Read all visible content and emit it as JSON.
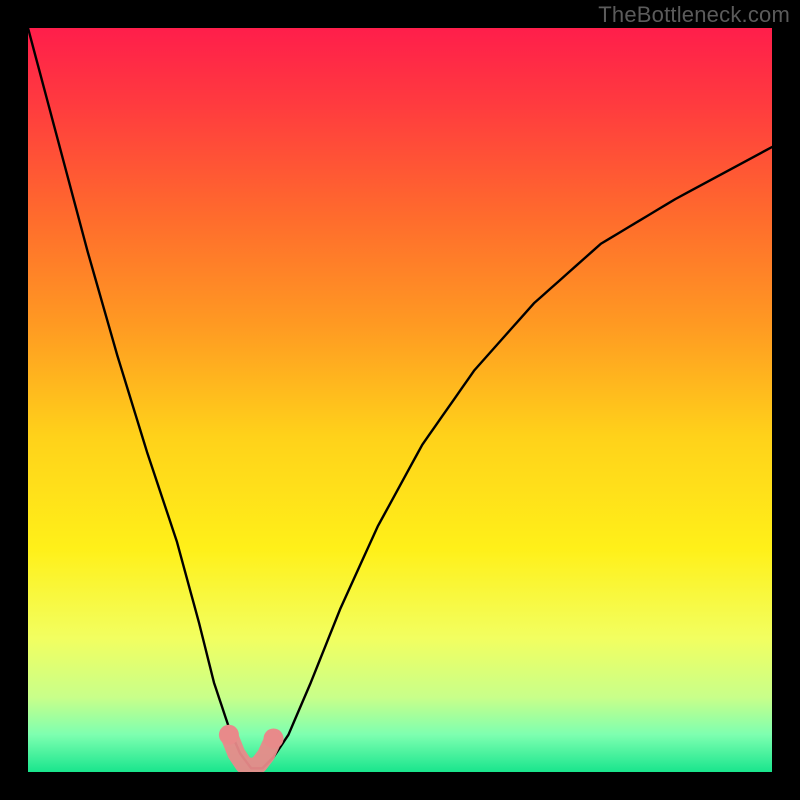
{
  "watermark": {
    "text": "TheBottleneck.com"
  },
  "chart_data": {
    "type": "line",
    "title": "",
    "xlabel": "",
    "ylabel": "",
    "xlim": [
      0,
      100
    ],
    "ylim": [
      0,
      100
    ],
    "grid": false,
    "legend": false,
    "gradient_stops": [
      {
        "pct": 0,
        "color": "#ff1e4b"
      },
      {
        "pct": 10,
        "color": "#ff3a3f"
      },
      {
        "pct": 25,
        "color": "#ff6a2d"
      },
      {
        "pct": 40,
        "color": "#ff9a22"
      },
      {
        "pct": 55,
        "color": "#ffd21a"
      },
      {
        "pct": 70,
        "color": "#fff019"
      },
      {
        "pct": 82,
        "color": "#f2ff60"
      },
      {
        "pct": 90,
        "color": "#c8ff8a"
      },
      {
        "pct": 95,
        "color": "#7dffb0"
      },
      {
        "pct": 100,
        "color": "#19e58d"
      }
    ],
    "series": [
      {
        "name": "bottleneck-curve",
        "x": [
          0,
          4,
          8,
          12,
          16,
          20,
          23,
          25,
          27,
          28.5,
          30,
          31.5,
          33,
          35,
          38,
          42,
          47,
          53,
          60,
          68,
          77,
          87,
          100
        ],
        "y": [
          100,
          85,
          70,
          56,
          43,
          31,
          20,
          12,
          6,
          2.5,
          0.5,
          0.5,
          2,
          5,
          12,
          22,
          33,
          44,
          54,
          63,
          71,
          77,
          84
        ]
      }
    ],
    "highlight_segment": {
      "name": "marker-band",
      "x": [
        27,
        28,
        29,
        30,
        31,
        32,
        33
      ],
      "y": [
        5,
        2.5,
        1,
        0.6,
        1,
        2.3,
        4.5
      ]
    },
    "curve_minimum": {
      "x": 30,
      "y": 0.5
    }
  }
}
